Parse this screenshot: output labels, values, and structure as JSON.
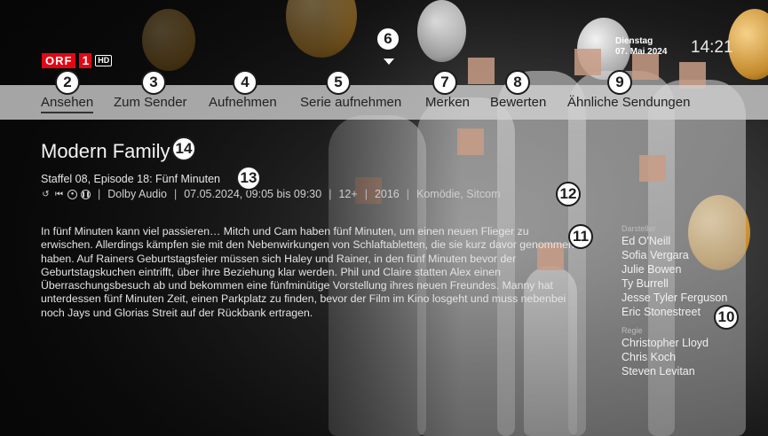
{
  "channel": {
    "logo_text": "ORF",
    "logo_number": "1",
    "quality_badge": "HD"
  },
  "header": {
    "weekday": "Dienstag",
    "date": "07. Mai 2024",
    "time": "14:21"
  },
  "menu": [
    {
      "label": "Ansehen",
      "active": true
    },
    {
      "label": "Zum Sender"
    },
    {
      "label": "Aufnehmen"
    },
    {
      "label": "Serie aufnehmen"
    },
    {
      "label": "Merken"
    },
    {
      "label": "Bewerten"
    },
    {
      "label": "Ähnliche Sendungen"
    }
  ],
  "program": {
    "title": "Modern Family",
    "episode": "Staffel 08, Episode 18: Fünf Minuten",
    "audio": "Dolby Audio",
    "airtime": "07.05.2024, 09:05 bis 09:30",
    "age_rating": "12+",
    "year": "2016",
    "genre": "Komödie, Sitcom",
    "description": "In fünf Minuten kann viel passieren… Mitch und Cam haben fünf Minuten, um einen neuen Flieger zu erwischen. Allerdings kämpfen sie mit den Nebenwirkungen von Schlaftabletten, die sie kurz davor genommen haben. Auf Rainers Geburtstagsfeier müssen sich Haley und Rainer, in den fünf Minuten bevor der Geburtstagskuchen eintrifft, über ihre Beziehung klar werden. Phil und Claire statten Alex einen Überraschungsbesuch ab und bekommen eine fünfminütige Vorstellung ihres neuen Freundes. Manny hat unterdessen fünf Minuten Zeit, einen Parkplatz zu finden, bevor der Film im Kino losgeht und muss nebenbei noch Jays und Glorias Streit auf der Rückbank ertragen."
  },
  "credits": {
    "cast_label": "Darsteller",
    "cast": [
      "Ed O'Neill",
      "Sofia Vergara",
      "Julie Bowen",
      "Ty Burrell",
      "Jesse Tyler Ferguson",
      "Eric Stonestreet"
    ],
    "director_label": "Regie",
    "directors": [
      "Christopher Lloyd",
      "Chris Koch",
      "Steven Levitan"
    ]
  },
  "annotations": [
    "2",
    "3",
    "4",
    "5",
    "6",
    "7",
    "8",
    "9",
    "10",
    "11",
    "12",
    "13",
    "14"
  ],
  "icons": [
    "restart-icon",
    "skip-back-icon",
    "record-icon",
    "pause-icon",
    "down-arrow-icon"
  ],
  "colors": {
    "orf_red": "#e30613",
    "menu_bar": "#d2d2d2",
    "badge_border": "#1b1b1b"
  }
}
